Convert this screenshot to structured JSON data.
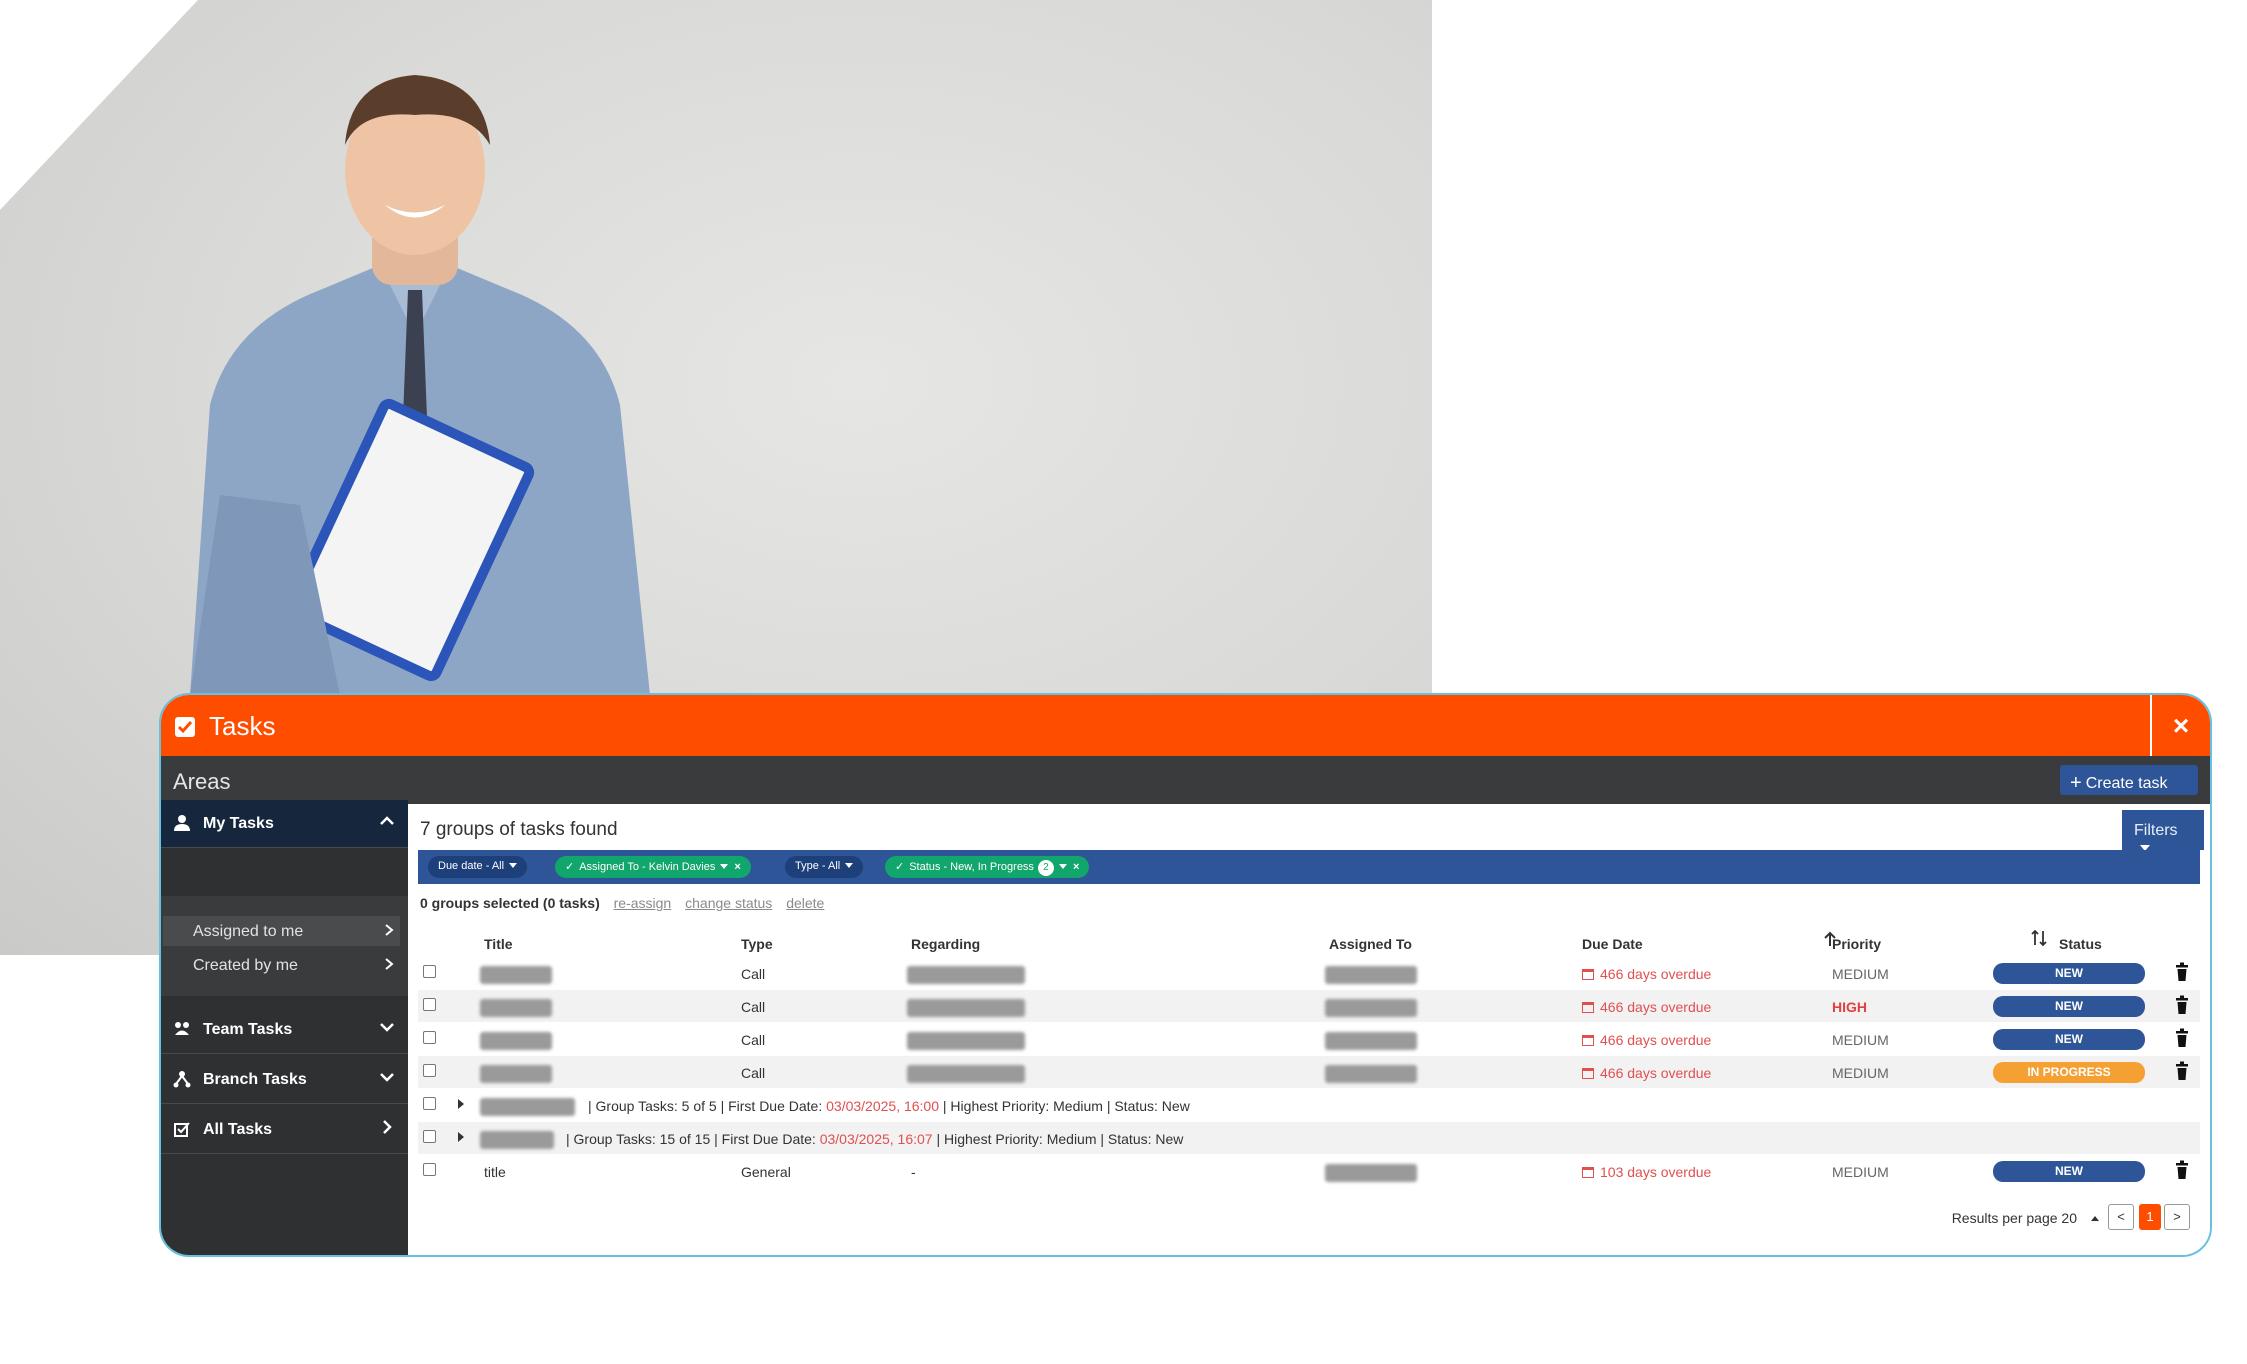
{
  "window": {
    "title": "Tasks",
    "close_icon": "×"
  },
  "sidebar": {
    "heading": "Areas",
    "items": [
      {
        "label": "My Tasks",
        "icon": "user-icon"
      },
      {
        "label": "Team Tasks",
        "icon": "team-icon"
      },
      {
        "label": "Branch Tasks",
        "icon": "branch-icon"
      },
      {
        "label": "All Tasks",
        "icon": "all-tasks-icon"
      }
    ],
    "subitems": [
      {
        "label": "Assigned to me"
      },
      {
        "label": "Created by me"
      }
    ]
  },
  "toolbar": {
    "create_label": "Create task",
    "filters_label": "Filters"
  },
  "results": {
    "summary": "7 groups of tasks found",
    "selected": "0 groups selected (0 tasks)",
    "actions": [
      "re-assign",
      "change status",
      "delete"
    ]
  },
  "filters": [
    {
      "label": "Due date - All"
    },
    {
      "label": "Assigned To - Kelvin Davies"
    },
    {
      "label": "Type - All"
    },
    {
      "label": "Status - New, In Progress",
      "badge": "2"
    }
  ],
  "table": {
    "headers": [
      "Title",
      "Type",
      "Regarding",
      "Assigned To",
      "Due Date",
      "Priority",
      "Status"
    ],
    "rows": [
      {
        "type": "Call",
        "due": "466 days overdue",
        "priority": "MEDIUM",
        "status": "NEW"
      },
      {
        "type": "Call",
        "due": "466 days overdue",
        "priority": "HIGH",
        "status": "NEW"
      },
      {
        "type": "Call",
        "due": "466 days overdue",
        "priority": "MEDIUM",
        "status": "NEW"
      },
      {
        "type": "Call",
        "due": "466 days overdue",
        "priority": "MEDIUM",
        "status": "IN PROGRESS"
      },
      {
        "title": "title",
        "type": "General",
        "regarding": "-",
        "due": "103 days overdue",
        "priority": "MEDIUM",
        "status": "NEW"
      }
    ],
    "groups": [
      {
        "count": "| Group Tasks: 5 of 5",
        "first_due_label": "| First Due Date:",
        "first_due": "03/03/2025, 16:00",
        "priority": "| Highest Priority: Medium",
        "status": "| Status: New"
      },
      {
        "count": "| Group Tasks: 15 of 15",
        "first_due_label": "| First Due Date:",
        "first_due": "03/03/2025, 16:07",
        "priority": "| Highest Priority: Medium",
        "status": "| Status: New"
      }
    ]
  },
  "pagination": {
    "results_per_page": "Results per page 20",
    "prev": "<",
    "current": "1",
    "next": ">"
  },
  "colors": {
    "accent": "#ff4d00",
    "navy": "#2e5597",
    "green": "#11a66b",
    "overdue": "#e05050",
    "in_progress": "#f5a032"
  }
}
